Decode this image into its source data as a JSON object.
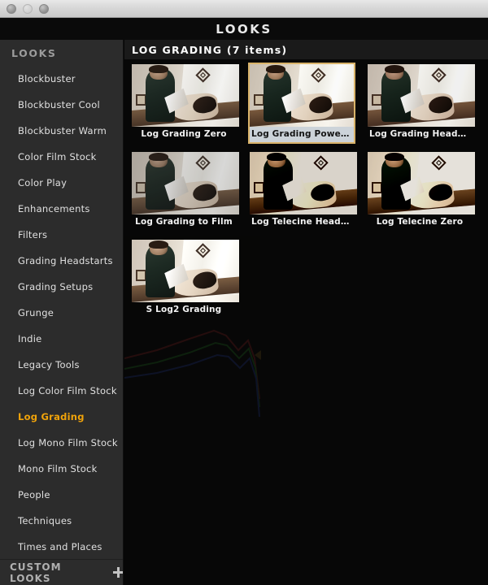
{
  "window": {
    "traffic_lights": [
      "close-button",
      "minimize-button",
      "zoom-button"
    ],
    "app_title": "LOOKS"
  },
  "sidebar": {
    "header": "LOOKS",
    "items": [
      {
        "label": "Blockbuster",
        "active": false
      },
      {
        "label": "Blockbuster Cool",
        "active": false
      },
      {
        "label": "Blockbuster Warm",
        "active": false
      },
      {
        "label": "Color Film Stock",
        "active": false
      },
      {
        "label": "Color Play",
        "active": false
      },
      {
        "label": "Enhancements",
        "active": false
      },
      {
        "label": "Filters",
        "active": false
      },
      {
        "label": "Grading Headstarts",
        "active": false
      },
      {
        "label": "Grading Setups",
        "active": false
      },
      {
        "label": "Grunge",
        "active": false
      },
      {
        "label": "Indie",
        "active": false
      },
      {
        "label": "Legacy Tools",
        "active": false
      },
      {
        "label": "Log Color Film Stock",
        "active": false
      },
      {
        "label": "Log Grading",
        "active": true
      },
      {
        "label": "Log Mono Film Stock",
        "active": false
      },
      {
        "label": "Mono Film Stock",
        "active": false
      },
      {
        "label": "People",
        "active": false
      },
      {
        "label": "Techniques",
        "active": false
      },
      {
        "label": "Times and Places",
        "active": false
      }
    ],
    "footer": {
      "label": "CUSTOM LOOKS",
      "add_icon": "plus-icon"
    },
    "active_accent_color": "#f0a30a"
  },
  "content": {
    "header_title": "LOG GRADING (7 items)",
    "category": "LOG GRADING",
    "item_count": 7,
    "items": [
      {
        "label": "Log Grading Zero",
        "selected": false,
        "look": "look-zero"
      },
      {
        "label": "Log Grading Power Suite",
        "selected": true,
        "look": "look-power"
      },
      {
        "label": "Log Grading Headstart",
        "selected": false,
        "look": "look-headstart"
      },
      {
        "label": "Log Grading to Film",
        "selected": false,
        "look": "look-tofilm"
      },
      {
        "label": "Log Telecine Headstart",
        "selected": false,
        "look": "look-telehead"
      },
      {
        "label": "Log Telecine Zero",
        "selected": false,
        "look": "look-telezero"
      },
      {
        "label": "S Log2 Grading",
        "selected": false,
        "look": "look-slog2"
      }
    ],
    "selection_border_color": "#d9b36a",
    "selection_label_bg": "#ccd3d9"
  }
}
